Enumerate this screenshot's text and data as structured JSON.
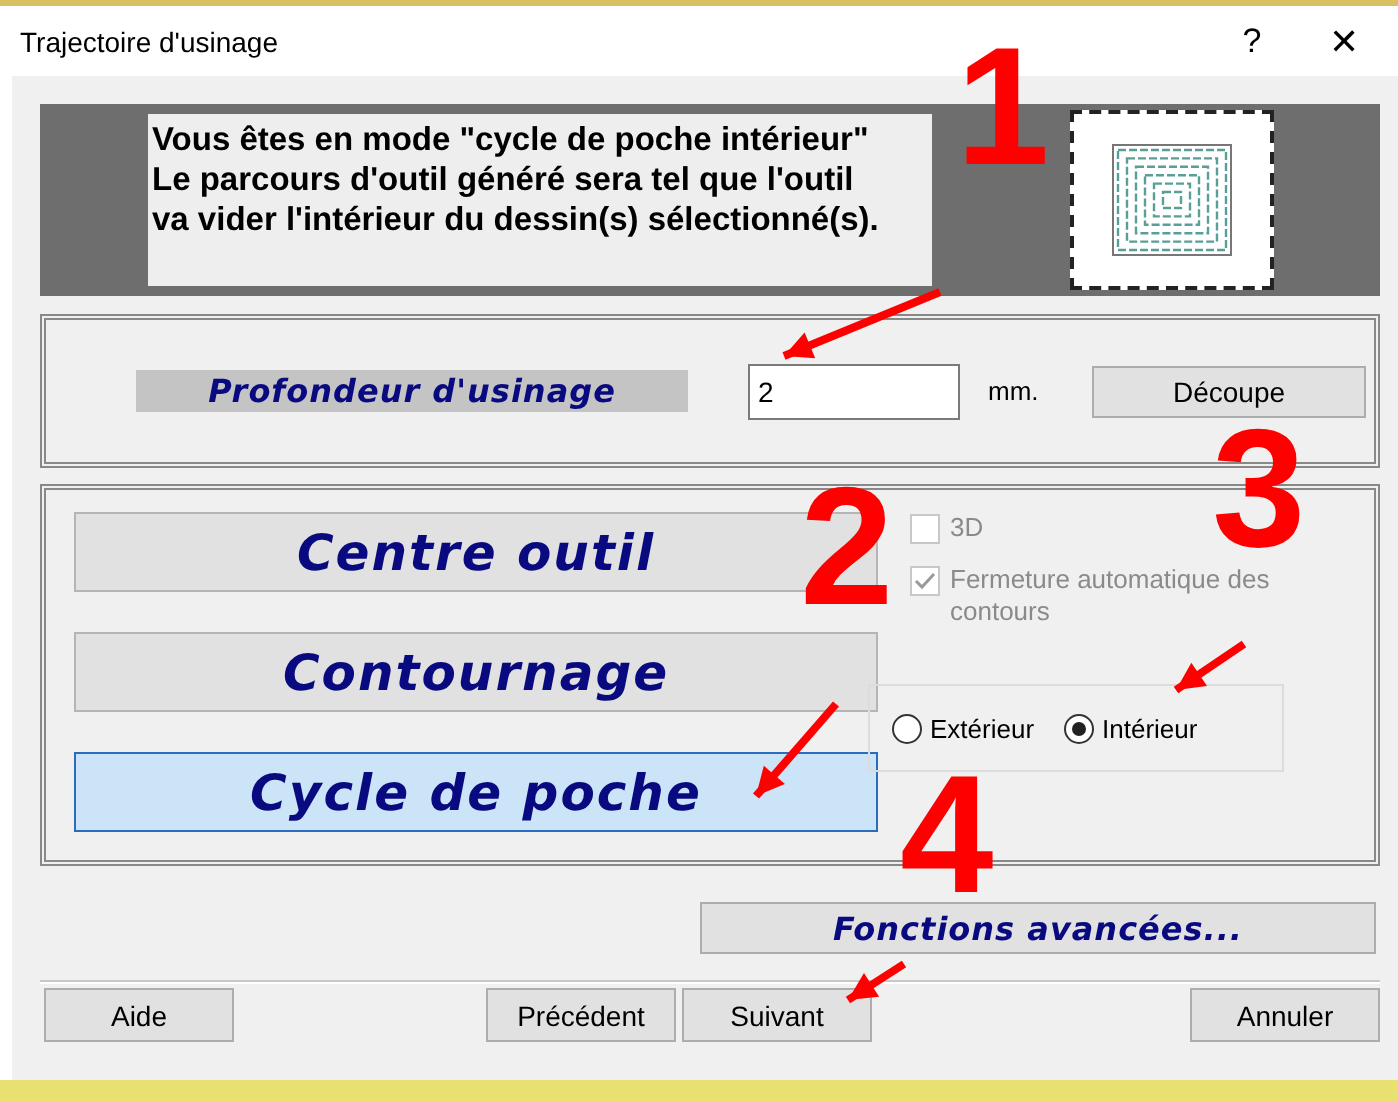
{
  "window": {
    "title": "Trajectoire d'usinage",
    "help_button": "?",
    "close_button": "✕"
  },
  "info": {
    "lines": [
      "Vous êtes en mode \"cycle de poche intérieur\"",
      "Le parcours d'outil généré sera tel que l'outil",
      "va vider l'intérieur du dessin(s) sélectionné(s)."
    ]
  },
  "depth": {
    "label": "Profondeur d'usinage",
    "value": "2",
    "unit": "mm.",
    "button": "Découpe"
  },
  "modes": [
    {
      "label": "Centre outil",
      "selected": false
    },
    {
      "label": "Contournage",
      "selected": false
    },
    {
      "label": "Cycle de poche",
      "selected": true
    }
  ],
  "options": [
    {
      "label": "3D",
      "checked": false,
      "disabled": true
    },
    {
      "label": "Fermeture automatique des contours",
      "checked": true,
      "disabled": true
    }
  ],
  "side": [
    {
      "label": "Extérieur",
      "selected": false
    },
    {
      "label": "Intérieur",
      "selected": true
    }
  ],
  "advanced_button": "Fonctions avancées...",
  "buttons": [
    "Aide",
    "Précédent",
    "Suivant",
    "Annuler"
  ],
  "annotations": [
    {
      "label": "1"
    },
    {
      "label": "2"
    },
    {
      "label": "3"
    },
    {
      "label": "4"
    }
  ]
}
